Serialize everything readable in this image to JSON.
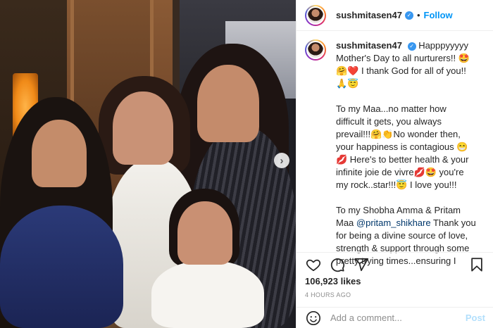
{
  "post": {
    "username": "sushmitasen47",
    "follow_label": "Follow",
    "dot": "•",
    "verified_glyph": "✓"
  },
  "caption": {
    "p1": "Happpyyyyy Mother's Day to all nurturers!! 🤩🤗❤️ I thank God for all of you!!🙏😇",
    "p2": "To my Maa...no matter how difficult it gets, you always prevail!!!🤗👏No wonder then, your happiness is contagious 😁💋 Here's to better health & your infinite joie de vivre💋🤩 you're my rock..star!!!😇 I love you!!!",
    "p3_before": "To my Shobha Amma & Pritam Maa ",
    "p3_mention": "@pritam_shikhare",
    "p3_after": " Thank you for being a divine source of love, strength & support through some pretty trying times...ensuring I always came back stronger!!👏😁❤️ Such a blessing to be born to your hearts...I love you!!"
  },
  "engagement": {
    "likes": "106,923 likes",
    "timestamp": "4 HOURS AGO"
  },
  "comment": {
    "placeholder": "Add a comment...",
    "post_label": "Post"
  },
  "photo": {
    "next_glyph": "›"
  },
  "colors": {
    "accent": "#0095f6",
    "verified": "#3897f0"
  }
}
